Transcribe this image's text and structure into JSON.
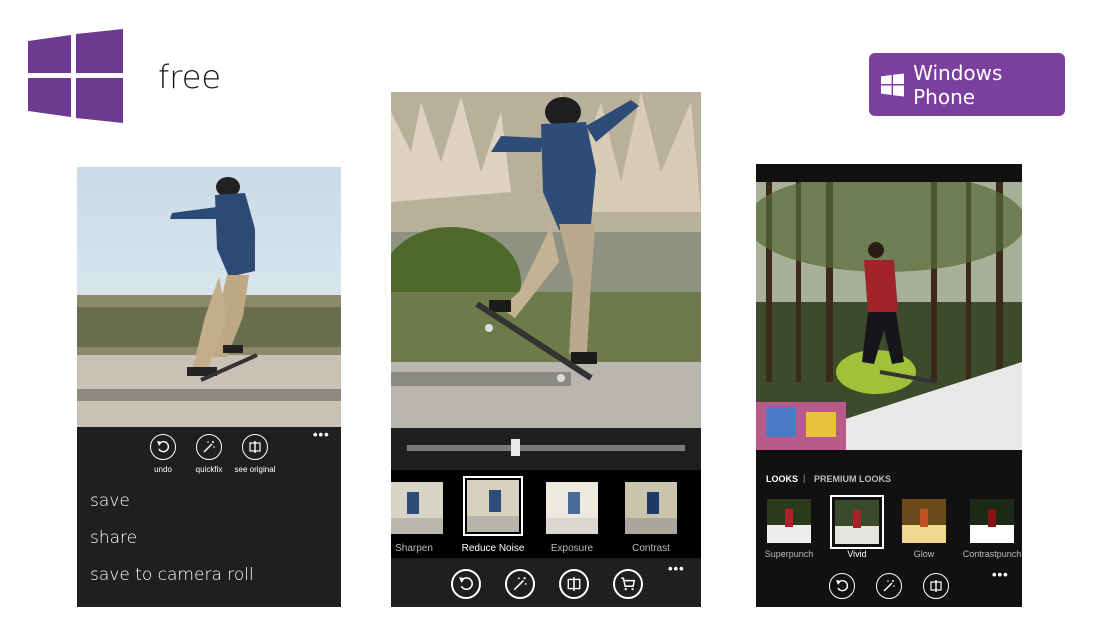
{
  "header": {
    "free_label": "free",
    "badge_label": "Windows Phone",
    "brand_color": "#7b3fa0"
  },
  "phone1": {
    "actions": [
      {
        "label": "undo",
        "icon": "undo-icon"
      },
      {
        "label": "quickfix",
        "icon": "magic-wand-icon"
      },
      {
        "label": "see original",
        "icon": "compare-icon"
      }
    ],
    "more": "•••",
    "menu": [
      "save",
      "share",
      "save to camera roll"
    ]
  },
  "phone2": {
    "slider_value": 0.39,
    "filters": [
      "Sharpen",
      "Reduce Noise",
      "Exposure",
      "Contrast"
    ],
    "selected_filter": "Reduce Noise",
    "toolbar_icons": [
      "undo-icon",
      "magic-wand-icon",
      "compare-icon",
      "cart-icon"
    ],
    "more": "•••"
  },
  "phone3": {
    "tabs": [
      "LOOKS",
      "PREMIUM LOOKS"
    ],
    "tab_separator": "|",
    "looks": [
      "Superpunch",
      "Vivid",
      "Glow",
      "Contrastpunch"
    ],
    "selected_look": "Vivid",
    "toolbar_icons": [
      "undo-icon",
      "magic-wand-icon",
      "compare-icon"
    ],
    "more": "•••"
  }
}
